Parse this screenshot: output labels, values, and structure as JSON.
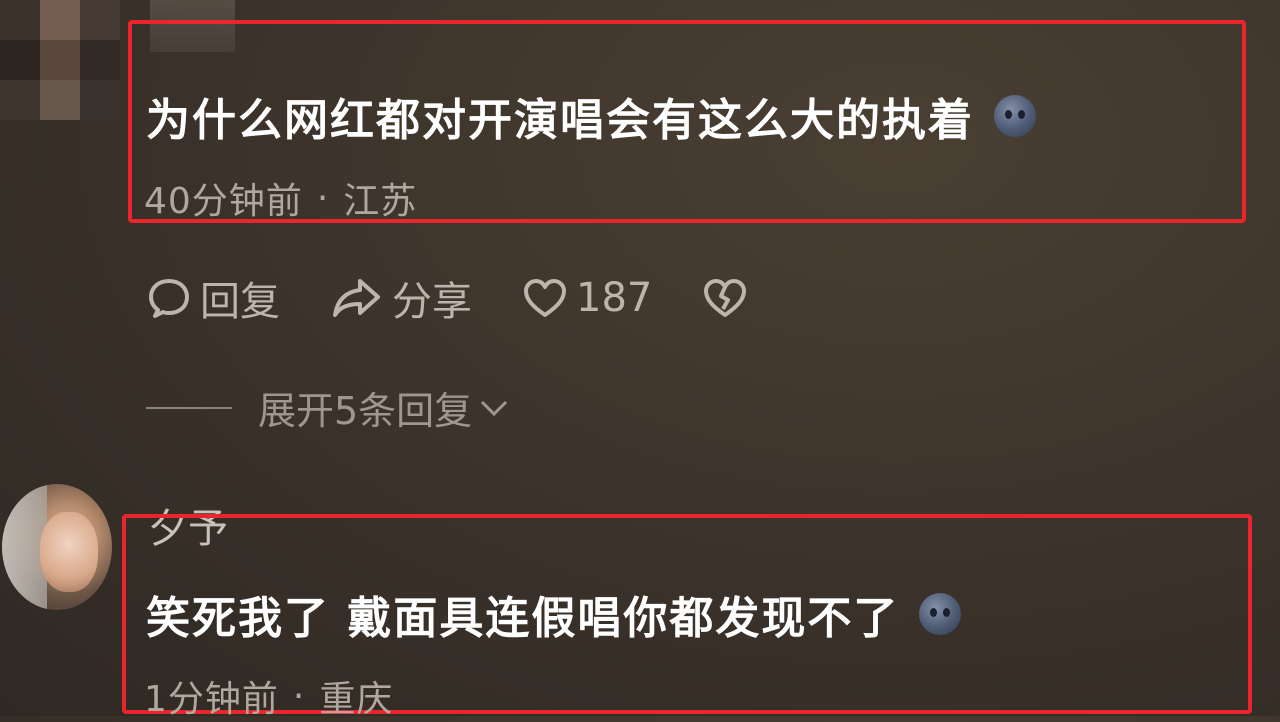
{
  "comments": [
    {
      "text": "为什么网红都对开演唱会有这么大的执着",
      "time": "40分钟前",
      "separator": "·",
      "location": "江苏",
      "emoji": "face-emoji"
    },
    {
      "username": "夕予",
      "text": "笑死我了 戴面具连假唱你都发现不了",
      "time": "1分钟前",
      "separator": "·",
      "location": "重庆",
      "emoji": "face-emoji"
    }
  ],
  "actions": {
    "reply_label": "回复",
    "share_label": "分享",
    "like_count": "187",
    "reply_icon": "comment-bubble-icon",
    "share_icon": "share-arrow-icon",
    "like_icon": "heart-icon",
    "dislike_icon": "broken-heart-icon"
  },
  "expand": {
    "label": "展开5条回复",
    "icon": "chevron-down-icon"
  },
  "colors": {
    "highlight": "#e8262b",
    "background": "#3d342b"
  }
}
